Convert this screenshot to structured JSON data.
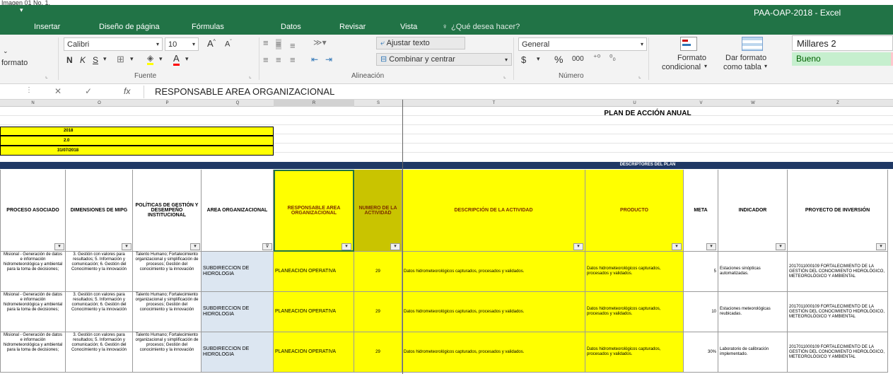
{
  "caption": "Imagen 01 No. 1.",
  "window_title": "PAA-OAP-2018 - Excel",
  "tabs": [
    "Insertar",
    "Diseño de página",
    "Fórmulas",
    "Datos",
    "Revisar",
    "Vista",
    "¿Qué desea hacer?"
  ],
  "ribbon": {
    "format_painter": "formato",
    "font_name": "Calibri",
    "font_size": "10",
    "bold": "N",
    "italic": "K",
    "underline": "S",
    "fuente_label": "Fuente",
    "wrap_text": "Ajustar texto",
    "merge_center": "Combinar y centrar",
    "alineacion_label": "Alineación",
    "number_format": "General",
    "currency": "$",
    "percent": "%",
    "thousands": "000",
    "numero_label": "Número",
    "cond_format_1": "Formato",
    "cond_format_2": "condicional",
    "table_format_1": "Dar formato",
    "table_format_2": "como tabla",
    "style_millares": "Millares 2",
    "style_bueno": "Bueno"
  },
  "formula_bar": {
    "fx": "fx",
    "content": "RESPONSABLE AREA ORGANIZACIONAL"
  },
  "columns": [
    "N",
    "O",
    "P",
    "Q",
    "R",
    "S",
    "T",
    "U",
    "V",
    "W",
    "Z"
  ],
  "sheet": {
    "plan_title": "PLAN DE ACCIÓN ANUAL",
    "year": "2018",
    "version": "2.0",
    "date": "31/07/2018",
    "descriptores": "DESCRIPTORES DEL PLAN",
    "headers": [
      "PROCESO ASOCIADO",
      "DIMENSIONES DE MIPG",
      "POLÍTICAS DE GESTIÓN Y DESEMPEÑO INSTITUCIONAL",
      "AREA ORGANIZACIONAL",
      "RESPONSABLE AREA ORGANIZACIONAL",
      "NUMERO DE LA ACTIVIDAD",
      "DESCRIPCIÓN DE LA ACTIVIDAD",
      "PRODUCTO",
      "META",
      "INDICADOR",
      "PROYECTO DE INVERSIÓN"
    ],
    "rows": [
      {
        "proceso": "Misional - Generación de datos e información hidrometeorológica y ambiental para la toma de decisiones;",
        "dimensiones": "3. Gestión con valores para resultados; 5. Información y comunicación; 6. Gestión del Conocimiento y la innovación",
        "politicas": "Talento Humano; Fortalecimiento organizacional y simplificación de procesos; Gestión del conocimiento y la innovación",
        "area": "SUBDIRECCION DE HIDROLOGIA",
        "responsable": "PLANEACION OPERATIVA",
        "numero": "29",
        "descripcion": "Datos hidrometeorológicos capturados, procesados y validados.",
        "producto": "Datos hidrometeorológicos capturados, procesados y validados.",
        "meta": "5",
        "indicador": "Estaciones sinópticas automatizadas.",
        "proyecto": "2017011000109 FORTALECIMIENTO DE LA GESTIÓN DEL CONOCIMIENTO HIDROLÓGICO, METEOROLÓGICO Y AMBIENTAL"
      },
      {
        "proceso": "Misional - Generación de datos e información hidrometeorológica y ambiental para la toma de decisiones;",
        "dimensiones": "3. Gestión con valores para resultados; 5. Información y comunicación; 6. Gestión del Conocimiento y la innovación",
        "politicas": "Talento Humano; Fortalecimiento organizacional y simplificación de procesos; Gestión del conocimiento y la innovación",
        "area": "SUBDIRECCION DE HIDROLOGIA",
        "responsable": "PLANEACION OPERATIVA",
        "numero": "29",
        "descripcion": "Datos hidrometeorológicos capturados, procesados y validados.",
        "producto": "Datos hidrometeorológicos capturados, procesados y validados.",
        "meta": "10",
        "indicador": "Estaciones meteorológicas reubicadas.",
        "proyecto": "2017011000109 FORTALECIMIENTO DE LA GESTIÓN DEL CONOCIMIENTO HIDROLÓGICO, METEOROLÓGICO Y AMBIENTAL"
      },
      {
        "proceso": "Misional - Generación de datos e información hidrometeorológica y ambiental para la toma de decisiones;",
        "dimensiones": "3. Gestión con valores para resultados; 5. Información y comunicación; 6. Gestión del Conocimiento y la innovación",
        "politicas": "Talento Humano; Fortalecimiento organizacional y simplificación de procesos; Gestión del conocimiento y la innovación",
        "area": "SUBDIRECCION DE HIDROLOGIA",
        "responsable": "PLANEACION OPERATIVA",
        "numero": "29",
        "descripcion": "Datos hidrometeorológicos capturados, procesados y validados.",
        "producto": "Datos hidrometeorológicos capturados, procesados y validados.",
        "meta": "30%",
        "indicador": "Laboratorio de calibración implementado.",
        "proyecto": "2017011000109 FORTALECIMIENTO DE LA GESTIÓN DEL CONOCIMIENTO HIDROLÓGICO, METEOROLÓGICO Y AMBIENTAL"
      }
    ]
  }
}
